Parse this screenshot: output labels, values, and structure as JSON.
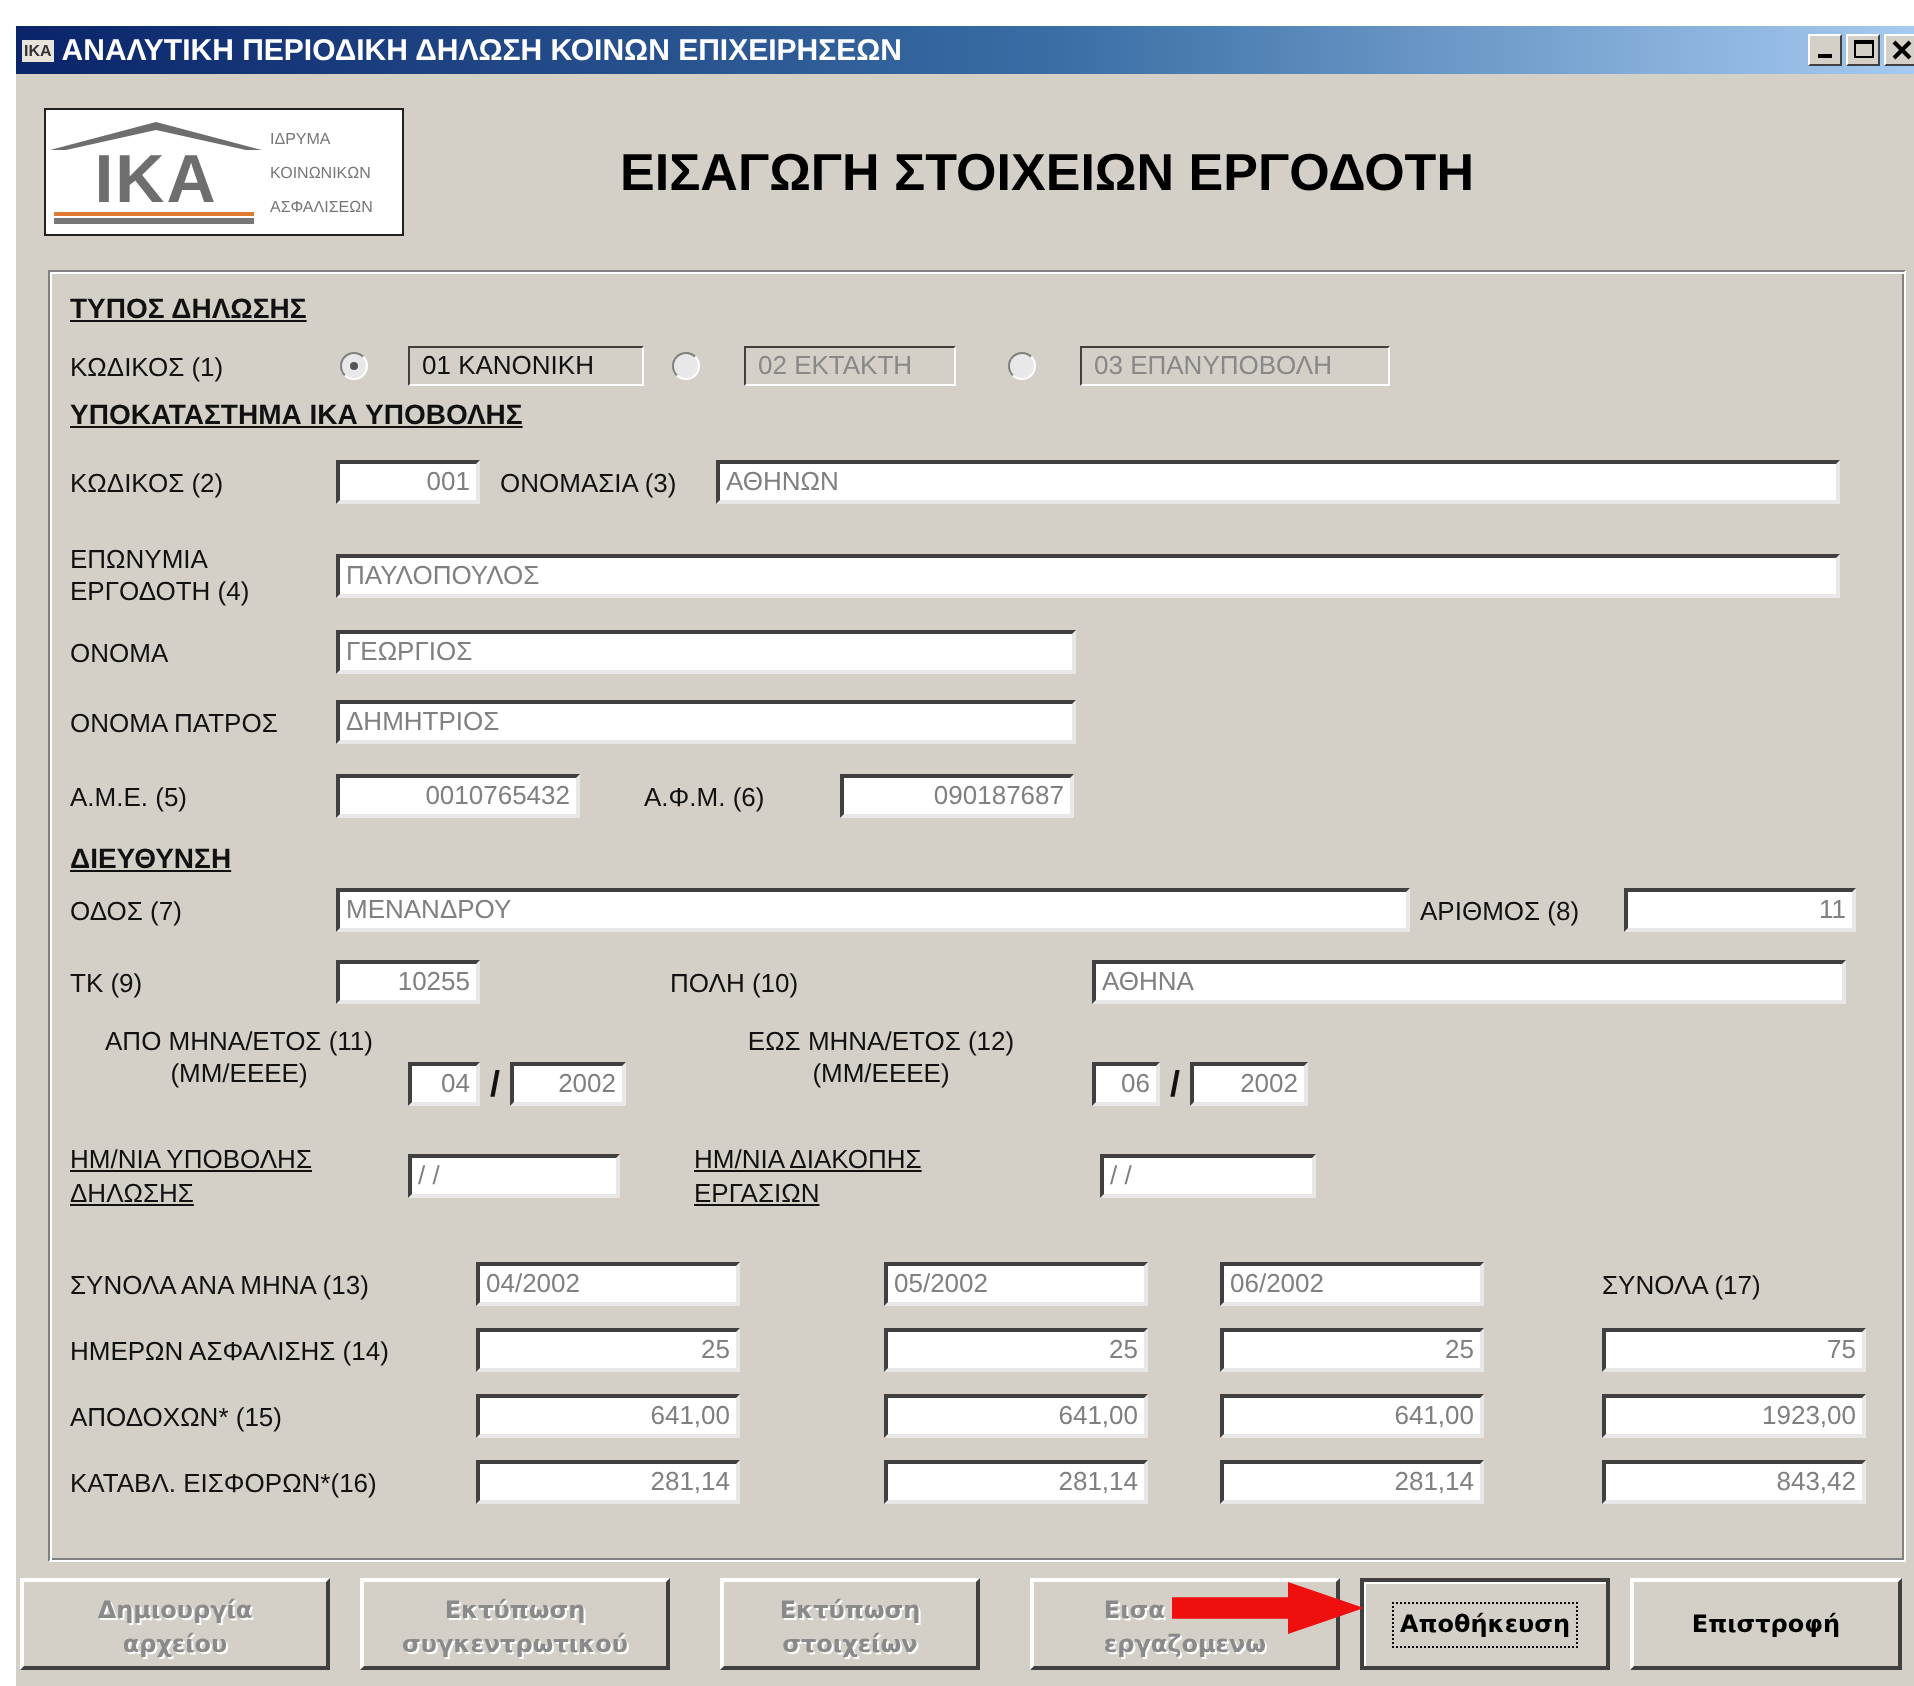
{
  "window": {
    "title": "ΑΝΑΛΥΤΙΚΗ ΠΕΡΙΟΔΙΚΗ ΔΗΛΩΣΗ ΚΟΙΝΩΝ ΕΠΙΧΕΙΡΗΣΕΩΝ",
    "icon_text": "IKA"
  },
  "logo": {
    "letters": "IKA",
    "lines": [
      "ΙΔΡΥΜΑ",
      "ΚΟΙΝΩΝΙΚΩΝ",
      "ΑΣΦΑΛΙΣΕΩΝ"
    ]
  },
  "heading": "ΕΙΣΑΓΩΓΗ ΣΤΟΙΧΕΙΩΝ ΕΡΓΟΔΟΤΗ",
  "declaration_type": {
    "title": "ΤΥΠΟΣ ΔΗΛΩΣΗΣ",
    "label": "ΚΩΔΙΚΟΣ (1)",
    "options": [
      {
        "value": "01 ΚΑΝΟΝΙΚΗ",
        "selected": true
      },
      {
        "value": "02 ΕΚΤΑΚΤΗ",
        "selected": false
      },
      {
        "value": "03 ΕΠΑΝΥΠΟΒΟΛΗ",
        "selected": false
      }
    ]
  },
  "branch": {
    "title": "ΥΠΟΚΑΤΑΣΤΗΜΑ ΙΚΑ ΥΠΟΒΟΛΗΣ",
    "code_label": "ΚΩΔΙΚΟΣ (2)",
    "code": "001",
    "name_label": "ΟΝΟΜΑΣΙΑ (3)",
    "name": "ΑΘΗΝΩΝ"
  },
  "employer": {
    "surname_label": "ΕΠΩΝΥΜΙΑ ΕΡΓΟΔΟΤΗ (4)",
    "surname": "ΠΑΥΛΟΠΟΥΛΟΣ",
    "first_name_label": "ΟΝΟΜΑ",
    "first_name": "ΓΕΩΡΓΙΟΣ",
    "father_label": "ΟΝΟΜΑ ΠΑΤΡΟΣ",
    "father": "ΔΗΜΗΤΡΙΟΣ",
    "ame_label": "Α.Μ.Ε. (5)",
    "ame": "0010765432",
    "afm_label": "Α.Φ.Μ.  (6)",
    "afm": "090187687"
  },
  "address": {
    "title": "ΔΙΕΥΘΥΝΣΗ",
    "street_label": "ΟΔΟΣ (7)",
    "street": "ΜΕΝΑΝΔΡΟΥ",
    "number_label": "ΑΡΙΘΜΟΣ (8)",
    "number": "11",
    "zip_label": "ΤΚ (9)",
    "zip": "10255",
    "city_label": "ΠΟΛΗ (10)",
    "city": "ΑΘΗΝΑ"
  },
  "period": {
    "from_label": "ΑΠΟ ΜΗΝΑ/ΕΤΟΣ (11)",
    "from_format": "(ΜΜ/ΕΕΕΕ)",
    "from_month": "04",
    "from_year": "2002",
    "to_label": "ΕΩΣ ΜΗΝΑ/ΕΤΟΣ (12)",
    "to_format": "(ΜΜ/ΕΕΕΕ)",
    "to_month": "06",
    "to_year": "2002",
    "separator": "/"
  },
  "dates": {
    "submission_label": "ΗΜ/ΝΙΑ ΥΠΟΒΟΛΗΣ ΔΗΛΩΣΗΣ",
    "submission": "/ /",
    "stop_label": "ΗΜ/ΝΙΑ ΔΙΑΚΟΠΗΣ ΕΡΓΑΣΙΩΝ",
    "stop": "/ /"
  },
  "totals": {
    "label": "ΣΥΝΟΛΑ ΑΝΑ ΜΗΝΑ (13)",
    "months": [
      "04/2002",
      "05/2002",
      "06/2002"
    ],
    "total_heading": "ΣΥΝΟΛΑ (17)",
    "rows": [
      {
        "label": "ΗΜΕΡΩΝ ΑΣΦΑΛΙΣΗΣ (14)",
        "values": [
          "25",
          "25",
          "25"
        ],
        "total": "75"
      },
      {
        "label": "ΑΠΟΔΟΧΩΝ* (15)",
        "values": [
          "641,00",
          "641,00",
          "641,00"
        ],
        "total": "1923,00"
      },
      {
        "label": "ΚΑΤΑΒΛ. ΕΙΣΦΟΡΩΝ*(16)",
        "values": [
          "281,14",
          "281,14",
          "281,14"
        ],
        "total": "843,42"
      }
    ]
  },
  "buttons": [
    {
      "lines": [
        "Δημιουργία",
        "αρχείου"
      ],
      "disabled": true,
      "focused": false
    },
    {
      "lines": [
        "Εκτύπωση",
        "συγκεντρωτικού"
      ],
      "disabled": true,
      "focused": false
    },
    {
      "lines": [
        "Εκτύπωση",
        "στοιχείων"
      ],
      "disabled": true,
      "focused": false
    },
    {
      "lines": [
        "Εισα",
        "εργαζομενω"
      ],
      "disabled": true,
      "focused": false
    },
    {
      "lines": [
        "Αποθήκευση"
      ],
      "disabled": false,
      "focused": true
    },
    {
      "lines": [
        "Επιστροφή"
      ],
      "disabled": false,
      "focused": false
    }
  ]
}
